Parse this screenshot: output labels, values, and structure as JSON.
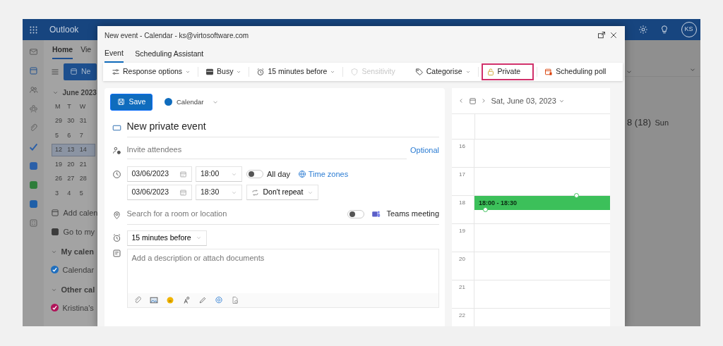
{
  "app": {
    "name": "Outlook",
    "tabs": [
      {
        "label": "Home",
        "selected": true
      },
      {
        "label": "Vie",
        "selected": false
      }
    ],
    "new_button": "Ne",
    "mini_calendar": {
      "title": "June 2023",
      "weekdays": [
        "M",
        "T",
        "W"
      ],
      "weeks": [
        {
          "days": [
            "29",
            "30",
            "31"
          ],
          "selected": false
        },
        {
          "days": [
            "5",
            "6",
            "7"
          ],
          "selected": false
        },
        {
          "days": [
            "12",
            "13",
            "14"
          ],
          "selected": true
        },
        {
          "days": [
            "19",
            "20",
            "21"
          ],
          "selected": false
        },
        {
          "days": [
            "26",
            "27",
            "28"
          ],
          "selected": false
        },
        {
          "days": [
            "3",
            "4",
            "5"
          ],
          "selected": false
        }
      ]
    },
    "nav_links": [
      "Add calen",
      "Go to my"
    ],
    "groups": [
      {
        "title": "My calen",
        "calendars": [
          {
            "name": "Calendar",
            "checked": true,
            "color": "#1f6fbf"
          }
        ]
      },
      {
        "title": "Other cal",
        "calendars": [
          {
            "name": "Kristina's",
            "checked": true,
            "color": "#b0145a"
          }
        ]
      }
    ],
    "day_heading": "8 (18)",
    "day_name": "Sun",
    "avatar": "KS"
  },
  "dialog": {
    "title": "New event - Calendar - ks@virtosoftware.com",
    "tabs": [
      {
        "label": "Event",
        "selected": true
      },
      {
        "label": "Scheduling Assistant",
        "selected": false
      }
    ],
    "toolbar": [
      {
        "label": "Response options",
        "dropdown": true,
        "disabled": false,
        "highlighted": false
      },
      {
        "label": "Busy",
        "dropdown": true,
        "disabled": false,
        "highlighted": false
      },
      {
        "label": "15 minutes before",
        "dropdown": true,
        "disabled": false,
        "highlighted": false
      },
      {
        "label": "Sensitivity",
        "dropdown": false,
        "disabled": true,
        "highlighted": false
      },
      {
        "label": "Categorise",
        "dropdown": true,
        "disabled": false,
        "highlighted": false
      },
      {
        "label": "Private",
        "dropdown": false,
        "disabled": false,
        "highlighted": true
      },
      {
        "label": "Scheduling poll",
        "dropdown": false,
        "disabled": false,
        "highlighted": false
      }
    ],
    "save": "Save",
    "calendar": {
      "name": "Calendar",
      "color": "#0f6cbd"
    },
    "event_title": "New private event",
    "attendees": {
      "placeholder": "Invite attendees",
      "optional": "Optional"
    },
    "start": {
      "date": "03/06/2023",
      "time": "18:00"
    },
    "all_day": {
      "label": "All day",
      "on": false
    },
    "time_zones": "Time zones",
    "end": {
      "date": "03/06/2023",
      "time": "18:30"
    },
    "repeat": "Don't repeat",
    "location": {
      "placeholder": "Search for a room or location"
    },
    "teams": {
      "label": "Teams meeting",
      "on": false
    },
    "reminder": "15 minutes before",
    "description": {
      "placeholder": "Add a description or attach documents"
    },
    "day_view": {
      "date": "Sat, June 03, 2023",
      "hours": [
        {
          "label": "16"
        },
        {
          "label": "17"
        },
        {
          "label": "18",
          "event": {
            "label": "18:00 - 18:30",
            "color": "#3cc05a"
          }
        },
        {
          "label": "19"
        },
        {
          "label": "20"
        },
        {
          "label": "21"
        },
        {
          "label": "22"
        }
      ]
    }
  }
}
